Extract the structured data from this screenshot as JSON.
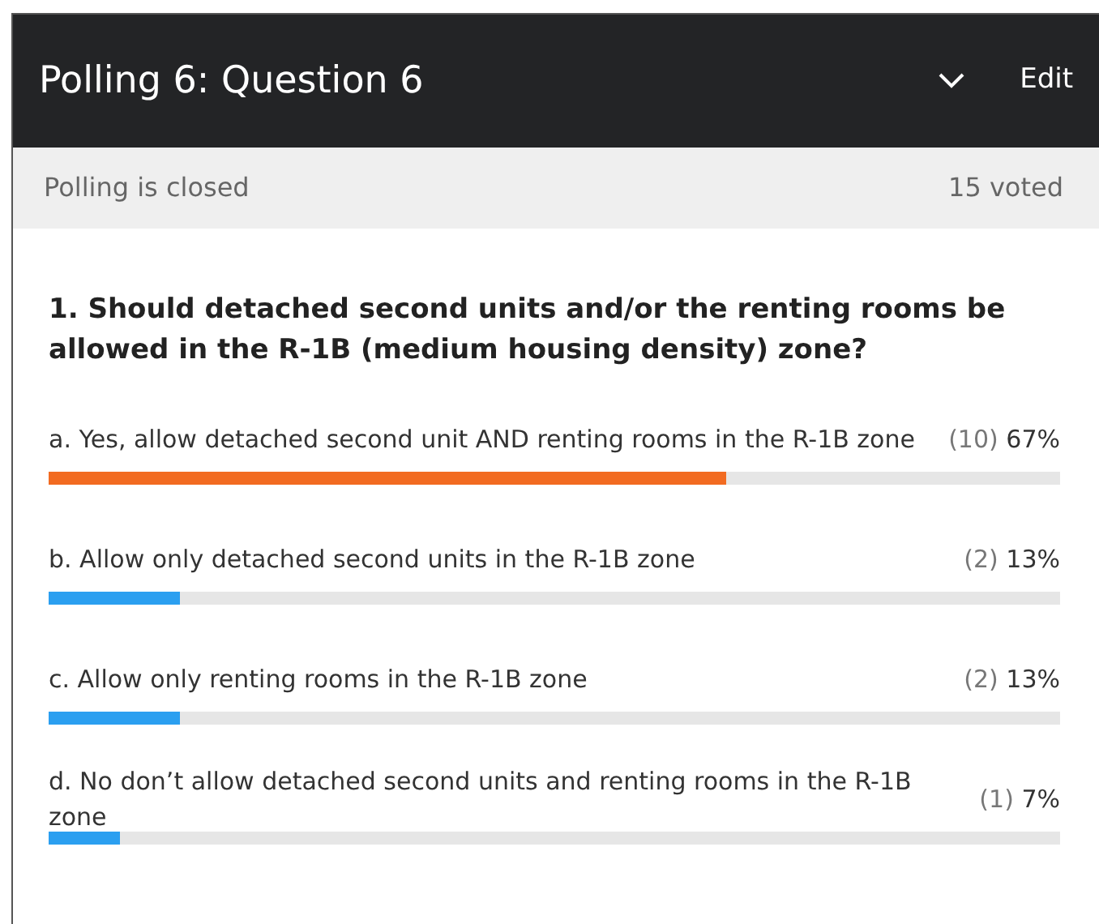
{
  "header": {
    "title": "Polling 6: Question 6",
    "edit": "Edit"
  },
  "status": {
    "state": "Polling is closed",
    "voted": "15 voted"
  },
  "question": "1. Should detached second units and/or the renting rooms be allowed in the R-1B (medium housing density) zone?",
  "answers": [
    {
      "text": "a. Yes, allow detached second unit AND renting rooms in the R-1B zone",
      "count": "(10)",
      "percent": "67%",
      "level": 0.67,
      "color": "#f26b21"
    },
    {
      "text": "b. Allow only detached second units in the R-1B zone",
      "count": "(2)",
      "percent": "13%",
      "level": 0.13,
      "color": "#2b9ff0"
    },
    {
      "text": "c. Allow only renting rooms in the R-1B zone",
      "count": "(2)",
      "percent": "13%",
      "level": 0.13,
      "color": "#2b9ff0"
    },
    {
      "text": "d. No don’t allow detached second units and renting rooms in the R-1B zone",
      "count": "(1)",
      "percent": "7%",
      "level": 0.07,
      "color": "#2b9ff0"
    }
  ]
}
